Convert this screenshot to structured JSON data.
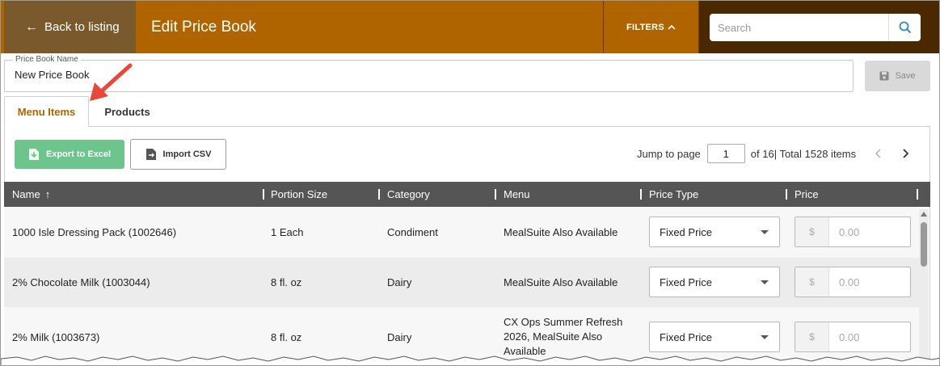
{
  "header": {
    "back_label": "Back to listing",
    "title": "Edit Price Book",
    "filters_label": "FILTERS",
    "search_placeholder": "Search",
    "colors": {
      "bar": "#b06400",
      "back": "#7a5a2d",
      "search_bg": "#4a2800"
    }
  },
  "name_field": {
    "label": "Price Book Name",
    "value": "New Price Book"
  },
  "save_label": "Save",
  "tabs": [
    {
      "label": "Menu Items",
      "active": true
    },
    {
      "label": "Products",
      "active": false
    }
  ],
  "toolbar": {
    "export_label": "Export to Excel",
    "import_label": "Import CSV"
  },
  "pager": {
    "jump_label": "Jump to page",
    "page": "1",
    "summary": "of 16| Total 1528 items"
  },
  "table": {
    "columns": [
      {
        "label": "Name",
        "sort": "↑"
      },
      {
        "label": "Portion Size"
      },
      {
        "label": "Category"
      },
      {
        "label": "Menu"
      },
      {
        "label": "Price Type"
      },
      {
        "label": "Price"
      }
    ],
    "rows": [
      {
        "name": "1000 Isle Dressing Pack (1002646)",
        "portion": "1 Each",
        "category": "Condiment",
        "menu": "MealSuite Also Available",
        "price_type": "Fixed Price",
        "currency": "$",
        "price": "0.00"
      },
      {
        "name": "2% Chocolate Milk (1003044)",
        "portion": "8 fl. oz",
        "category": "Dairy",
        "menu": "MealSuite Also Available",
        "price_type": "Fixed Price",
        "currency": "$",
        "price": "0.00"
      },
      {
        "name": "2% Milk (1003673)",
        "portion": "8 fl. oz",
        "category": "Dairy",
        "menu": "CX Ops Summer Refresh 2026, MealSuite Also Available",
        "price_type": "Fixed Price",
        "currency": "$",
        "price": "0.00"
      }
    ]
  },
  "colors": {
    "accent": "#b06400",
    "export_green": "#6dc48c",
    "table_header": "#555555",
    "annotation_arrow": "#e8473a"
  }
}
